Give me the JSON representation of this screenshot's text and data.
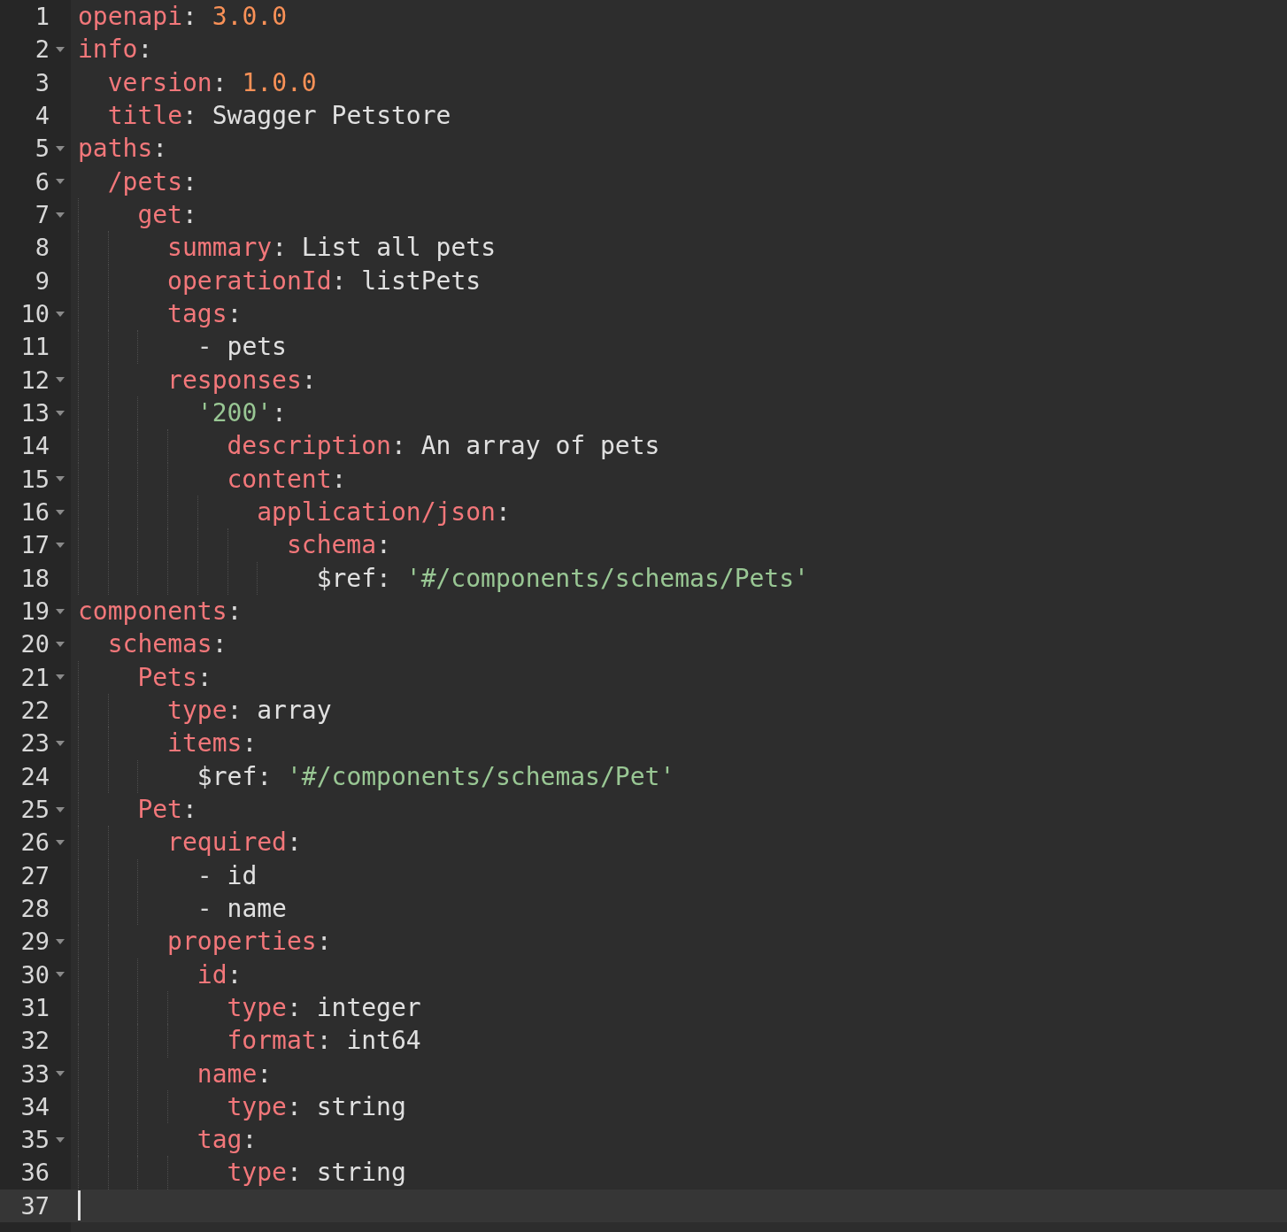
{
  "lines": [
    {
      "number": "1",
      "active": false,
      "tokens": [
        {
          "kind": "key",
          "text": "openapi"
        },
        {
          "kind": "punct",
          "text": ": "
        },
        {
          "kind": "number",
          "text": "3.0.0"
        }
      ]
    },
    {
      "number": "2",
      "active": false,
      "tokens": [
        {
          "kind": "key",
          "text": "info"
        },
        {
          "kind": "punct",
          "text": ":"
        }
      ],
      "children": [
        {
          "number": "3",
          "active": false,
          "tokens": [
            {
              "kind": "key",
              "text": "version"
            },
            {
              "kind": "punct",
              "text": ": "
            },
            {
              "kind": "number",
              "text": "1.0.0"
            }
          ]
        },
        {
          "number": "4",
          "active": false,
          "tokens": [
            {
              "kind": "key",
              "text": "title"
            },
            {
              "kind": "punct",
              "text": ": "
            },
            {
              "kind": "value",
              "text": "Swagger Petstore"
            }
          ]
        }
      ]
    },
    {
      "number": "5",
      "active": false,
      "tokens": [
        {
          "kind": "key",
          "text": "paths"
        },
        {
          "kind": "punct",
          "text": ":"
        }
      ],
      "children": [
        {
          "number": "6",
          "active": false,
          "tokens": [
            {
              "kind": "key",
              "text": "/pets"
            },
            {
              "kind": "punct",
              "text": ":"
            }
          ],
          "children": [
            {
              "number": "7",
              "active": false,
              "tokens": [
                {
                  "kind": "key",
                  "text": "get"
                },
                {
                  "kind": "punct",
                  "text": ":"
                }
              ],
              "children": [
                {
                  "number": "8",
                  "active": false,
                  "tokens": [
                    {
                      "kind": "key",
                      "text": "summary"
                    },
                    {
                      "kind": "punct",
                      "text": ": "
                    },
                    {
                      "kind": "value",
                      "text": "List all pets"
                    }
                  ]
                },
                {
                  "number": "9",
                  "active": false,
                  "tokens": [
                    {
                      "kind": "key",
                      "text": "operationId"
                    },
                    {
                      "kind": "punct",
                      "text": ": "
                    },
                    {
                      "kind": "value",
                      "text": "listPets"
                    }
                  ]
                },
                {
                  "number": "10",
                  "active": false,
                  "tokens": [
                    {
                      "kind": "key",
                      "text": "tags"
                    },
                    {
                      "kind": "punct",
                      "text": ":"
                    }
                  ],
                  "children": [
                    {
                      "number": "11",
                      "active": false,
                      "tokens": [
                        {
                          "kind": "punct",
                          "text": "- "
                        },
                        {
                          "kind": "value",
                          "text": "pets"
                        }
                      ]
                    }
                  ]
                },
                {
                  "number": "12",
                  "active": false,
                  "tokens": [
                    {
                      "kind": "key",
                      "text": "responses"
                    },
                    {
                      "kind": "punct",
                      "text": ":"
                    }
                  ],
                  "children": [
                    {
                      "number": "13",
                      "active": false,
                      "tokens": [
                        {
                          "kind": "string",
                          "text": "'200'"
                        },
                        {
                          "kind": "punct",
                          "text": ":"
                        }
                      ],
                      "children": [
                        {
                          "number": "14",
                          "active": false,
                          "tokens": [
                            {
                              "kind": "key",
                              "text": "description"
                            },
                            {
                              "kind": "punct",
                              "text": ": "
                            },
                            {
                              "kind": "value",
                              "text": "An array of pets"
                            }
                          ]
                        },
                        {
                          "number": "15",
                          "active": false,
                          "tokens": [
                            {
                              "kind": "key",
                              "text": "content"
                            },
                            {
                              "kind": "punct",
                              "text": ":"
                            }
                          ],
                          "children": [
                            {
                              "number": "16",
                              "active": false,
                              "tokens": [
                                {
                                  "kind": "key",
                                  "text": "application/json"
                                },
                                {
                                  "kind": "punct",
                                  "text": ":"
                                }
                              ],
                              "children": [
                                {
                                  "number": "17",
                                  "active": false,
                                  "tokens": [
                                    {
                                      "kind": "key",
                                      "text": "schema"
                                    },
                                    {
                                      "kind": "punct",
                                      "text": ":"
                                    }
                                  ],
                                  "children": [
                                    {
                                      "number": "18",
                                      "active": false,
                                      "tokens": [
                                        {
                                          "kind": "value",
                                          "text": "$ref"
                                        },
                                        {
                                          "kind": "punct",
                                          "text": ": "
                                        },
                                        {
                                          "kind": "string",
                                          "text": "'#/components/schemas/Pets'"
                                        }
                                      ]
                                    }
                                  ]
                                }
                              ]
                            }
                          ]
                        }
                      ]
                    }
                  ]
                }
              ]
            }
          ]
        }
      ]
    },
    {
      "number": "19",
      "active": false,
      "tokens": [
        {
          "kind": "key",
          "text": "components"
        },
        {
          "kind": "punct",
          "text": ":"
        }
      ],
      "children": [
        {
          "number": "20",
          "active": false,
          "tokens": [
            {
              "kind": "key",
              "text": "schemas"
            },
            {
              "kind": "punct",
              "text": ":"
            }
          ],
          "children": [
            {
              "number": "21",
              "active": false,
              "tokens": [
                {
                  "kind": "key",
                  "text": "Pets"
                },
                {
                  "kind": "punct",
                  "text": ":"
                }
              ],
              "children": [
                {
                  "number": "22",
                  "active": false,
                  "tokens": [
                    {
                      "kind": "key",
                      "text": "type"
                    },
                    {
                      "kind": "punct",
                      "text": ": "
                    },
                    {
                      "kind": "value",
                      "text": "array"
                    }
                  ]
                },
                {
                  "number": "23",
                  "active": false,
                  "tokens": [
                    {
                      "kind": "key",
                      "text": "items"
                    },
                    {
                      "kind": "punct",
                      "text": ":"
                    }
                  ],
                  "children": [
                    {
                      "number": "24",
                      "active": false,
                      "tokens": [
                        {
                          "kind": "value",
                          "text": "$ref"
                        },
                        {
                          "kind": "punct",
                          "text": ": "
                        },
                        {
                          "kind": "string",
                          "text": "'#/components/schemas/Pet'"
                        }
                      ]
                    }
                  ]
                }
              ]
            },
            {
              "number": "25",
              "active": false,
              "tokens": [
                {
                  "kind": "key",
                  "text": "Pet"
                },
                {
                  "kind": "punct",
                  "text": ":"
                }
              ],
              "children": [
                {
                  "number": "26",
                  "active": false,
                  "tokens": [
                    {
                      "kind": "key",
                      "text": "required"
                    },
                    {
                      "kind": "punct",
                      "text": ":"
                    }
                  ],
                  "children": [
                    {
                      "number": "27",
                      "active": false,
                      "tokens": [
                        {
                          "kind": "punct",
                          "text": "- "
                        },
                        {
                          "kind": "value",
                          "text": "id"
                        }
                      ]
                    },
                    {
                      "number": "28",
                      "active": false,
                      "tokens": [
                        {
                          "kind": "punct",
                          "text": "- "
                        },
                        {
                          "kind": "value",
                          "text": "name"
                        }
                      ]
                    }
                  ]
                },
                {
                  "number": "29",
                  "active": false,
                  "tokens": [
                    {
                      "kind": "key",
                      "text": "properties"
                    },
                    {
                      "kind": "punct",
                      "text": ":"
                    }
                  ],
                  "children": [
                    {
                      "number": "30",
                      "active": false,
                      "tokens": [
                        {
                          "kind": "key",
                          "text": "id"
                        },
                        {
                          "kind": "punct",
                          "text": ":"
                        }
                      ],
                      "children": [
                        {
                          "number": "31",
                          "active": false,
                          "tokens": [
                            {
                              "kind": "key",
                              "text": "type"
                            },
                            {
                              "kind": "punct",
                              "text": ": "
                            },
                            {
                              "kind": "value",
                              "text": "integer"
                            }
                          ]
                        },
                        {
                          "number": "32",
                          "active": false,
                          "tokens": [
                            {
                              "kind": "key",
                              "text": "format"
                            },
                            {
                              "kind": "punct",
                              "text": ": "
                            },
                            {
                              "kind": "value",
                              "text": "int64"
                            }
                          ]
                        }
                      ]
                    },
                    {
                      "number": "33",
                      "active": false,
                      "tokens": [
                        {
                          "kind": "key",
                          "text": "name"
                        },
                        {
                          "kind": "punct",
                          "text": ":"
                        }
                      ],
                      "children": [
                        {
                          "number": "34",
                          "active": false,
                          "tokens": [
                            {
                              "kind": "key",
                              "text": "type"
                            },
                            {
                              "kind": "punct",
                              "text": ": "
                            },
                            {
                              "kind": "value",
                              "text": "string"
                            }
                          ]
                        }
                      ]
                    },
                    {
                      "number": "35",
                      "active": false,
                      "tokens": [
                        {
                          "kind": "key",
                          "text": "tag"
                        },
                        {
                          "kind": "punct",
                          "text": ":"
                        }
                      ],
                      "children": [
                        {
                          "number": "36",
                          "active": false,
                          "tokens": [
                            {
                              "kind": "key",
                              "text": "type"
                            },
                            {
                              "kind": "punct",
                              "text": ": "
                            },
                            {
                              "kind": "value",
                              "text": "string"
                            }
                          ]
                        }
                      ]
                    }
                  ]
                }
              ]
            }
          ]
        }
      ]
    },
    {
      "number": "37",
      "active": true
    }
  ]
}
